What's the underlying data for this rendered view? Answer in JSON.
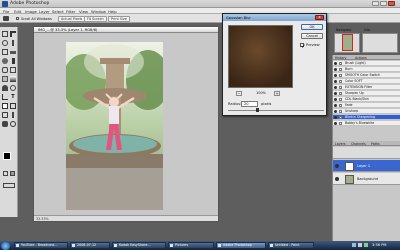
{
  "app": {
    "title": "Adobe Photoshop"
  },
  "menu": [
    "File",
    "Edit",
    "Image",
    "Layer",
    "Select",
    "Filter",
    "View",
    "Window",
    "Help"
  ],
  "options": {
    "scroll_all": "Scroll All Windows",
    "actual_pixels": "Actual Pixels",
    "fit_screen": "Fit Screen",
    "print_size": "Print Size"
  },
  "document": {
    "title": "IMG_…@ 33.3% (Layer 1, RGB/8)",
    "status": "33.33%"
  },
  "gaussian": {
    "title": "Gaussian Blur",
    "ok": "OK",
    "cancel": "Cancel",
    "preview": "Preview",
    "zoom": "100%",
    "radius_label": "Radius:",
    "radius_value": "20",
    "unit": "pixels",
    "close": "x"
  },
  "panels": {
    "tabs": [
      "Navigator",
      "Info"
    ],
    "history_tabs": [
      "History",
      "Actions"
    ],
    "layers_tabs": [
      "Layers",
      "Channels",
      "Paths"
    ],
    "history_items": [
      {
        "label": "Brush (Light)",
        "sel": false
      },
      {
        "label": "Burn",
        "sel": false
      },
      {
        "label": "SMOOTH Color Switch",
        "sel": false
      },
      {
        "label": "Color SOFT",
        "sel": false
      },
      {
        "label": "EXTENSION Filter",
        "sel": false
      },
      {
        "label": "Sharpen Up",
        "sel": false
      },
      {
        "label": "CDL Black/Skin",
        "sel": false
      },
      {
        "label": "Fade",
        "sel": false
      },
      {
        "label": "Unsharp",
        "sel": false
      },
      {
        "label": "Blinkin Sharpening",
        "sel": true
      },
      {
        "label": "Bobby's Bluewhite",
        "sel": false
      }
    ],
    "layers": [
      {
        "label": "Layer 1",
        "sel": true
      },
      {
        "label": "Background",
        "sel": false
      }
    ]
  },
  "taskbar": {
    "items": [
      {
        "label": "YouTube - Broadcast…",
        "active": false
      },
      {
        "label": "2008-07-12",
        "active": false
      },
      {
        "label": "Kodak EasyShare…",
        "active": false
      },
      {
        "label": "Pictures",
        "active": false
      },
      {
        "label": "Adobe Photoshop",
        "active": true
      },
      {
        "label": "Untitled - Paint",
        "active": false
      }
    ],
    "clock": "3:56 PM"
  },
  "colors": {
    "selection": "#2f5fd0",
    "title_active": "#7fa4cc"
  }
}
